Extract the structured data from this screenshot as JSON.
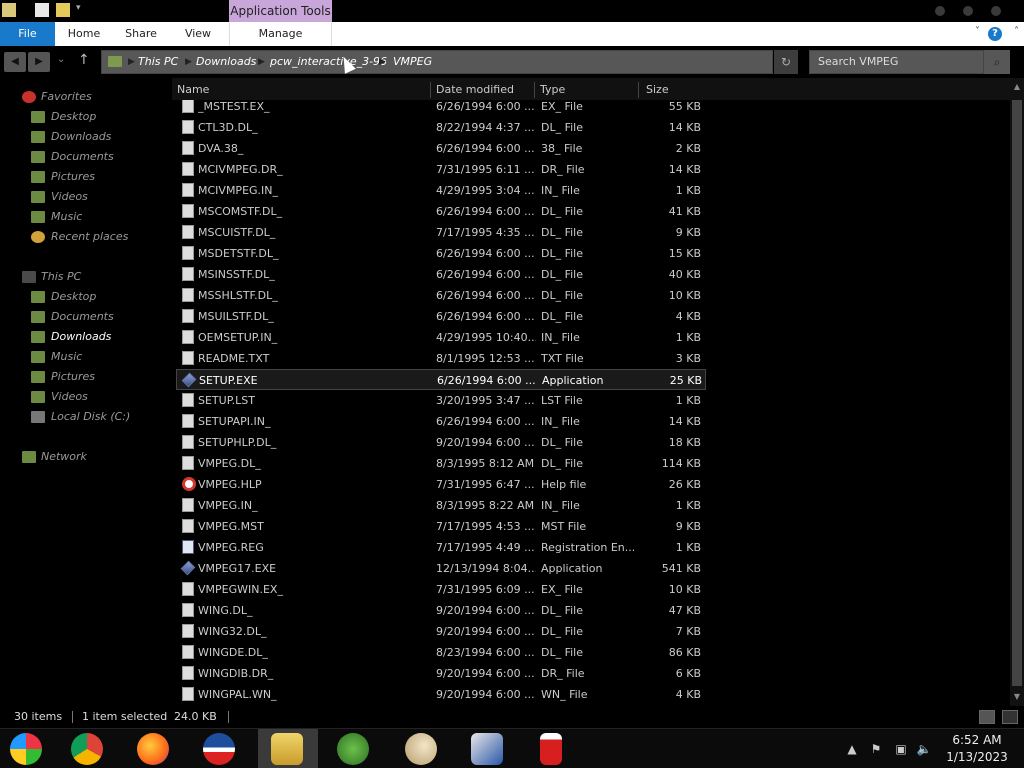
{
  "ribbon": {
    "context_label": "Application Tools",
    "tabs": [
      "File",
      "Home",
      "Share",
      "View",
      "Manage"
    ]
  },
  "address": {
    "crumbs": [
      "This PC",
      "Downloads",
      "pcw_interactive_3-96",
      "VMPEG"
    ],
    "search_placeholder": "Search VMPEG"
  },
  "nav": {
    "favorites_header": "Favorites",
    "favorites": [
      "Desktop",
      "Downloads",
      "Documents",
      "Pictures",
      "Videos",
      "Music",
      "Recent places"
    ],
    "thispc_header": "This PC",
    "thispc": [
      "Desktop",
      "Documents",
      "Downloads",
      "Music",
      "Pictures",
      "Videos",
      "Local Disk (C:)"
    ],
    "network": "Network",
    "selected": "Downloads"
  },
  "columns": {
    "name": "Name",
    "date": "Date modified",
    "type": "Type",
    "size": "Size"
  },
  "files": [
    {
      "name": "_MSTEST.EX_",
      "date": "6/26/1994 6:00 ...",
      "type": "EX_ File",
      "size": "55 KB",
      "icon": "file-icon"
    },
    {
      "name": "CTL3D.DL_",
      "date": "8/22/1994 4:37 ...",
      "type": "DL_ File",
      "size": "14 KB",
      "icon": "file-icon"
    },
    {
      "name": "DVA.38_",
      "date": "6/26/1994 6:00 ...",
      "type": "38_ File",
      "size": "2 KB",
      "icon": "file-icon"
    },
    {
      "name": "MCIVMPEG.DR_",
      "date": "7/31/1995 6:11 ...",
      "type": "DR_ File",
      "size": "14 KB",
      "icon": "file-icon"
    },
    {
      "name": "MCIVMPEG.IN_",
      "date": "4/29/1995 3:04 ...",
      "type": "IN_ File",
      "size": "1 KB",
      "icon": "file-icon"
    },
    {
      "name": "MSCOMSTF.DL_",
      "date": "6/26/1994 6:00 ...",
      "type": "DL_ File",
      "size": "41 KB",
      "icon": "file-icon"
    },
    {
      "name": "MSCUISTF.DL_",
      "date": "7/17/1995 4:35 ...",
      "type": "DL_ File",
      "size": "9 KB",
      "icon": "file-icon"
    },
    {
      "name": "MSDETSTF.DL_",
      "date": "6/26/1994 6:00 ...",
      "type": "DL_ File",
      "size": "15 KB",
      "icon": "file-icon"
    },
    {
      "name": "MSINSSTF.DL_",
      "date": "6/26/1994 6:00 ...",
      "type": "DL_ File",
      "size": "40 KB",
      "icon": "file-icon"
    },
    {
      "name": "MSSHLSTF.DL_",
      "date": "6/26/1994 6:00 ...",
      "type": "DL_ File",
      "size": "10 KB",
      "icon": "file-icon"
    },
    {
      "name": "MSUILSTF.DL_",
      "date": "6/26/1994 6:00 ...",
      "type": "DL_ File",
      "size": "4 KB",
      "icon": "file-icon"
    },
    {
      "name": "OEMSETUP.IN_",
      "date": "4/29/1995 10:40...",
      "type": "IN_ File",
      "size": "1 KB",
      "icon": "file-icon"
    },
    {
      "name": "README.TXT",
      "date": "8/1/1995 12:53 ...",
      "type": "TXT File",
      "size": "3 KB",
      "icon": "text-file-icon"
    },
    {
      "name": "SETUP.EXE",
      "date": "6/26/1994 6:00 ...",
      "type": "Application",
      "size": "25 KB",
      "icon": "application-icon",
      "selected": true
    },
    {
      "name": "SETUP.LST",
      "date": "3/20/1995 3:47 ...",
      "type": "LST File",
      "size": "1 KB",
      "icon": "file-icon"
    },
    {
      "name": "SETUPAPI.IN_",
      "date": "6/26/1994 6:00 ...",
      "type": "IN_ File",
      "size": "14 KB",
      "icon": "file-icon"
    },
    {
      "name": "SETUPHLP.DL_",
      "date": "9/20/1994 6:00 ...",
      "type": "DL_ File",
      "size": "18 KB",
      "icon": "file-icon"
    },
    {
      "name": "VMPEG.DL_",
      "date": "8/3/1995 8:12 AM",
      "type": "DL_ File",
      "size": "114 KB",
      "icon": "file-icon"
    },
    {
      "name": "VMPEG.HLP",
      "date": "7/31/1995 6:47 ...",
      "type": "Help file",
      "size": "26 KB",
      "icon": "help-file-icon"
    },
    {
      "name": "VMPEG.IN_",
      "date": "8/3/1995 8:22 AM",
      "type": "IN_ File",
      "size": "1 KB",
      "icon": "file-icon"
    },
    {
      "name": "VMPEG.MST",
      "date": "7/17/1995 4:53 ...",
      "type": "MST File",
      "size": "9 KB",
      "icon": "file-icon"
    },
    {
      "name": "VMPEG.REG",
      "date": "7/17/1995 4:49 ...",
      "type": "Registration En...",
      "size": "1 KB",
      "icon": "registry-file-icon"
    },
    {
      "name": "VMPEG17.EXE",
      "date": "12/13/1994 8:04...",
      "type": "Application",
      "size": "541 KB",
      "icon": "application-icon"
    },
    {
      "name": "VMPEGWIN.EX_",
      "date": "7/31/1995 6:09 ...",
      "type": "EX_ File",
      "size": "10 KB",
      "icon": "file-icon"
    },
    {
      "name": "WING.DL_",
      "date": "9/20/1994 6:00 ...",
      "type": "DL_ File",
      "size": "47 KB",
      "icon": "file-icon"
    },
    {
      "name": "WING32.DL_",
      "date": "9/20/1994 6:00 ...",
      "type": "DL_ File",
      "size": "7 KB",
      "icon": "file-icon"
    },
    {
      "name": "WINGDE.DL_",
      "date": "8/23/1994 6:00 ...",
      "type": "DL_ File",
      "size": "86 KB",
      "icon": "file-icon"
    },
    {
      "name": "WINGDIB.DR_",
      "date": "9/20/1994 6:00 ...",
      "type": "DR_ File",
      "size": "6 KB",
      "icon": "file-icon"
    },
    {
      "name": "WINGPAL.WN_",
      "date": "9/20/1994 6:00 ...",
      "type": "WN_ File",
      "size": "4 KB",
      "icon": "file-icon"
    }
  ],
  "status": {
    "item_count": "30 items",
    "selection": "1 item selected",
    "selection_size": "24.0 KB"
  },
  "taskbar": {
    "apps": [
      "start-orb-icon",
      "chrome-icon",
      "firefox-icon",
      "obama-logo-icon",
      "file-explorer-icon",
      "users-icon",
      "paint-icon",
      "windows-stack-icon",
      "red-phone-icon"
    ],
    "time": "6:52 AM",
    "date": "1/13/2023"
  },
  "colors": {
    "accent": "#1979ca",
    "context_tab": "#c9a6d9"
  }
}
